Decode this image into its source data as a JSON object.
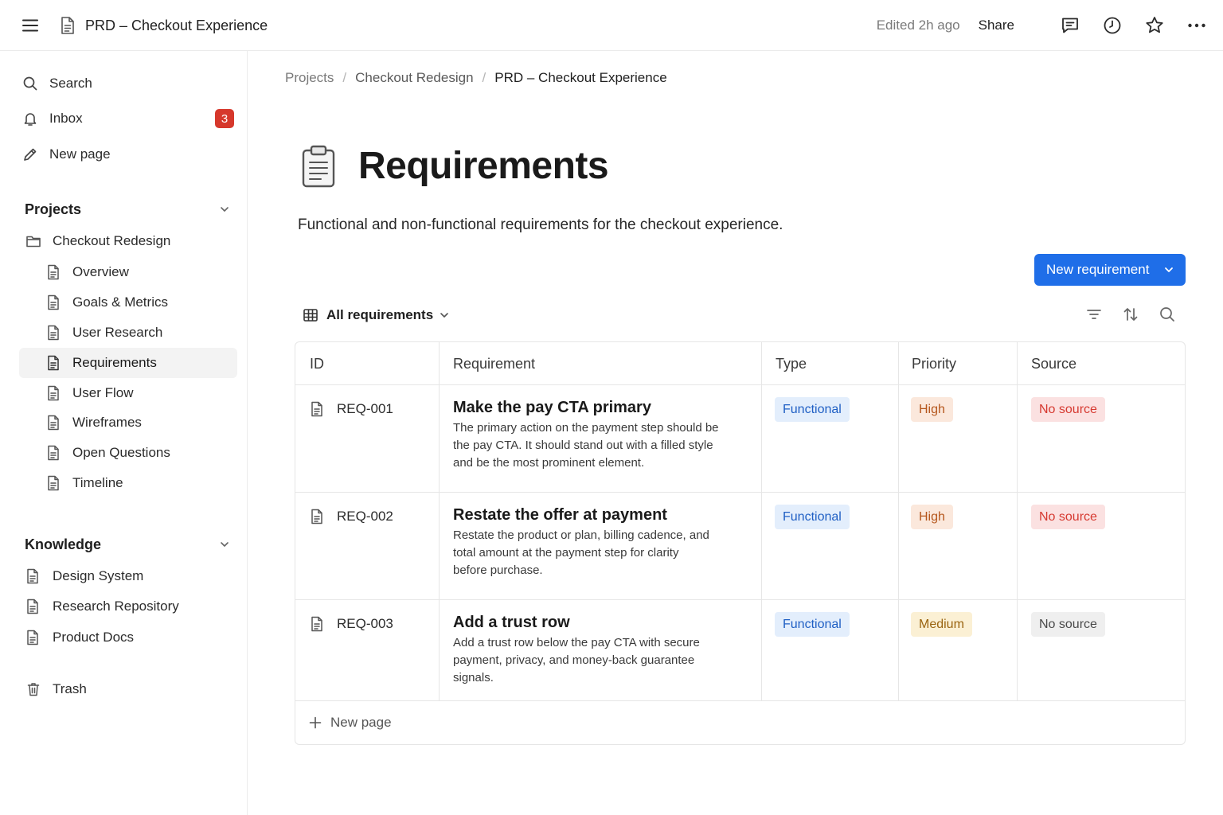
{
  "window": {
    "doc_title": "PRD – Checkout Experience",
    "edited": "Edited 2h ago",
    "share_label": "Share"
  },
  "sidebar": {
    "search_label": "Search",
    "inbox_label": "Inbox",
    "inbox_count": "3",
    "new_page_label": "New page",
    "projects_heading": "Projects",
    "project_name": "Checkout Redesign",
    "project_pages": [
      "Overview",
      "Goals & Metrics",
      "User Research",
      "Requirements",
      "User Flow",
      "Wireframes",
      "Open Questions",
      "Timeline"
    ],
    "knowledge_heading": "Knowledge",
    "knowledge_pages": [
      "Design System",
      "Research Repository",
      "Product Docs"
    ],
    "trash_label": "Trash"
  },
  "breadcrumb": [
    "Projects",
    "Checkout Redesign",
    "PRD – Checkout Experience"
  ],
  "page": {
    "title": "Requirements",
    "description": "Functional and non-functional requirements for the checkout experience.",
    "new_button_label": "New requirement",
    "view_label": "All requirements"
  },
  "table": {
    "columns": [
      "ID",
      "Requirement",
      "Type",
      "Priority",
      "Source"
    ],
    "rows": [
      {
        "id": "REQ-001",
        "title": "Make the pay CTA primary",
        "desc_lines": [
          "The primary action on the payment step should be",
          "the pay CTA. It should stand out with a filled style",
          "and be the most prominent element."
        ],
        "type": "Functional",
        "priority": "High",
        "source": "No source"
      },
      {
        "id": "REQ-002",
        "title": "Restate the offer at payment",
        "desc_lines": [
          "Restate the product or plan, billing cadence, and",
          "total amount at the payment step for clarity",
          "before purchase."
        ],
        "type": "Functional",
        "priority": "High",
        "source": "No source"
      },
      {
        "id": "REQ-003",
        "title": "Add a trust row",
        "desc_lines": [
          "Add a trust row below the pay CTA with secure",
          "payment, privacy, and money-back guarantee",
          "signals."
        ],
        "type": "Functional",
        "priority": "Medium",
        "source": "No source"
      }
    ],
    "new_row_label": "New page"
  },
  "colors": {
    "accent": "#1f6ee8",
    "badge": "#d6382c",
    "functional": "#1f5fc4",
    "high": "#b5561c",
    "medium": "#9a6410",
    "no_source_red": "#d63a31"
  }
}
